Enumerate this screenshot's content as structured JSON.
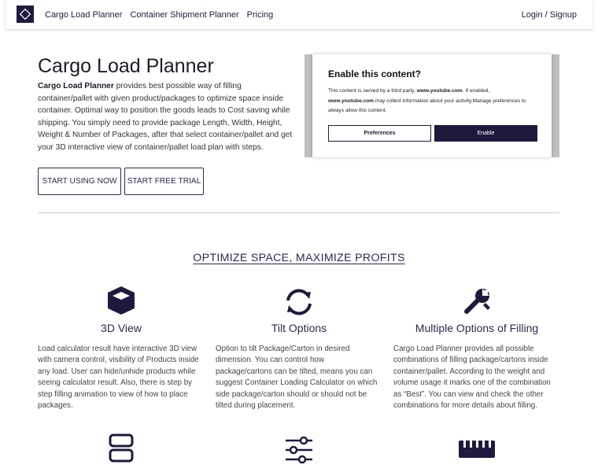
{
  "nav": {
    "links": [
      "Cargo Load Planner",
      "Container Shipment Planner",
      "Pricing"
    ],
    "login": "Login / Signup"
  },
  "hero": {
    "title": "Cargo Load Planner",
    "text_bold": "Cargo Load Planner",
    "text_rest": " provides best possible way of filling container/pallet with given product/packages to optimize space inside container. Optimal way to position the goods leads to Cost saving while shipping. You simply need to provide package Length, Width, Height, Weight & Number of Packages, after that select container/pallet and get your 3D interactive view of container/pallet load plan with steps.",
    "btn_start": "START USING NOW",
    "btn_trial": "START FREE TRIAL"
  },
  "embed": {
    "title": "Enable this content?",
    "msg_1": "This content is served by a third party, ",
    "domain_1": "www.youtube.com",
    "msg_2": ". If enabled, ",
    "domain_2": "www.youtube.com",
    "msg_3": " may collect information about your activity.Manage preferences to always allow this content.",
    "btn_pref": "Preferences",
    "btn_enable": "Enable"
  },
  "section": {
    "title": "OPTIMIZE SPACE, MAXIMIZE PROFITS"
  },
  "features": [
    {
      "icon": "cube-icon",
      "title": "3D View",
      "text": "Load calculator result have interactive 3D view with camera control, visibility of Products inside any load. User can hide/unhide products while seeing calculator result. Also, there is step by step filling animation to view of how to place packages."
    },
    {
      "icon": "sync-icon",
      "title": "Tilt Options",
      "text": "Option to tilt Package/Carton in desired dimension. You can control how package/cartons can be tilted, means you can suggest Container Loading Calculator on which side package/carton should or should not be tilted during placement."
    },
    {
      "icon": "wrench-icon",
      "title": "Multiple Options of Filling",
      "text": "Cargo Load Planner provides all possible combinations of filling package/cartons inside container/pallet. According to the weight and volume usage it marks one of the combination as “Best”. You can view and check the other combinations for more details about filling."
    },
    {
      "icon": "stacked-boxes-icon"
    },
    {
      "icon": "sliders-icon"
    },
    {
      "icon": "ruler-icon"
    }
  ],
  "colors": {
    "brand": "#1f1a3d",
    "accent": "#2e2850"
  }
}
